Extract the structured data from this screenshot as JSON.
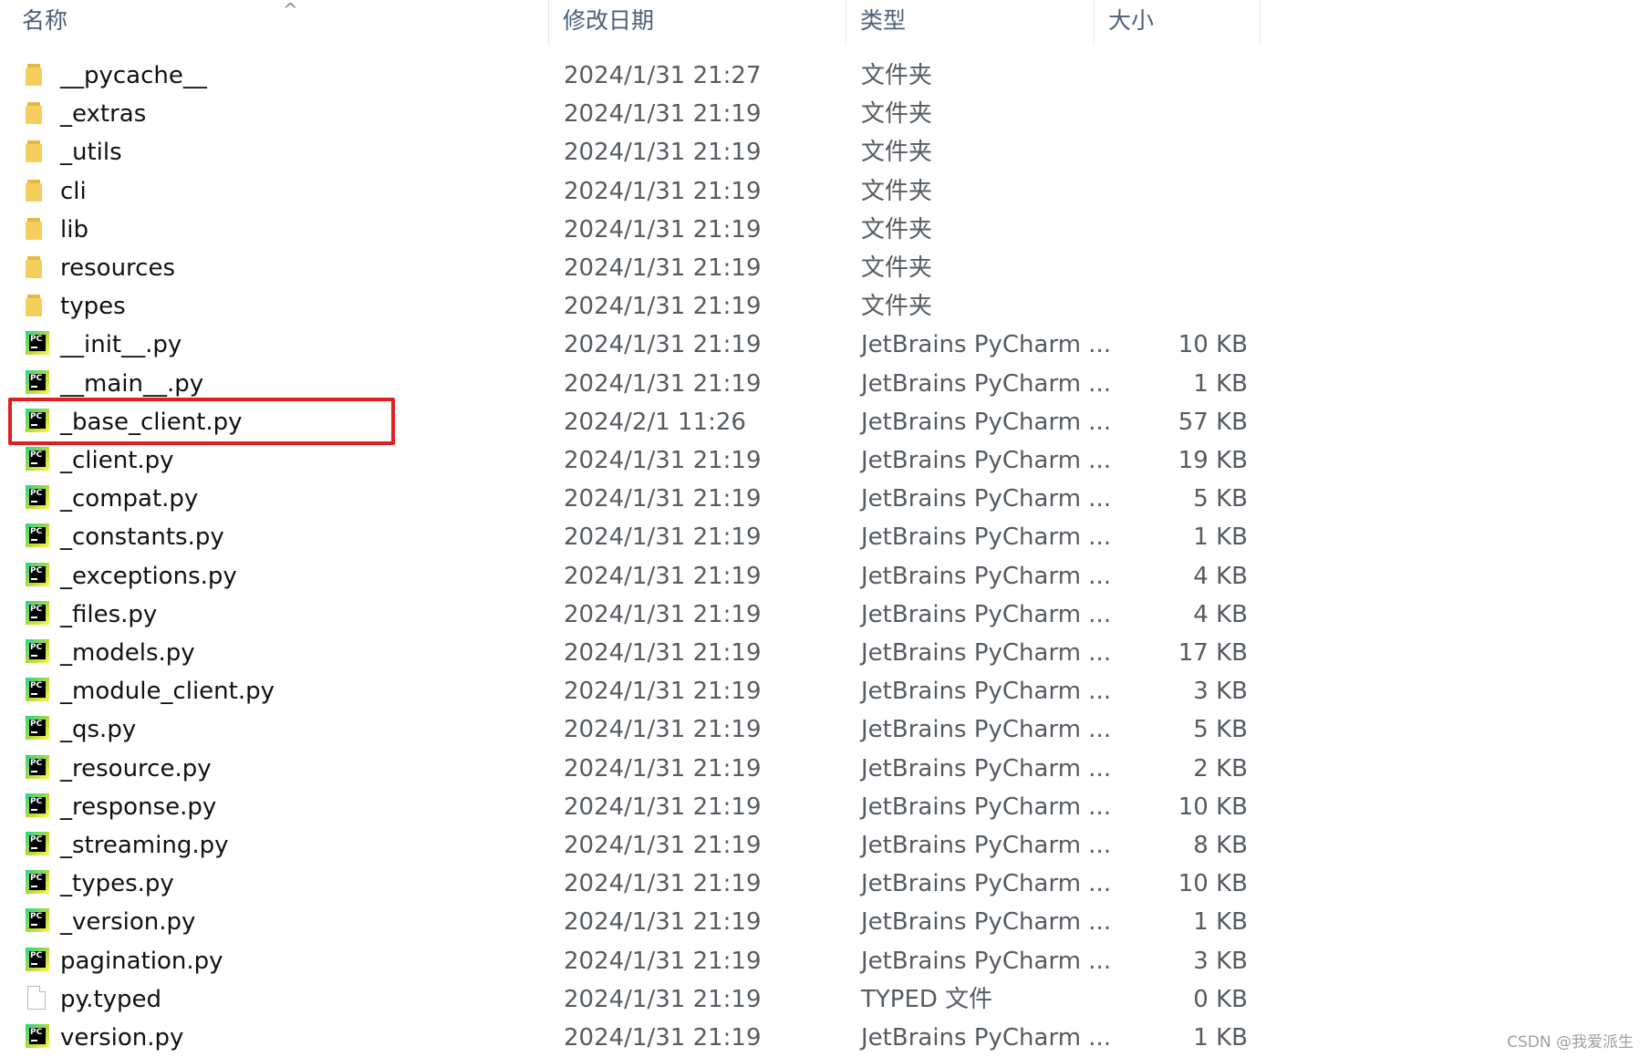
{
  "header": {
    "name": "名称",
    "date_modified": "修改日期",
    "type": "类型",
    "size": "大小",
    "sort_glyph": "^"
  },
  "files": [
    {
      "name": "__pycache__",
      "date": "2024/1/31 21:27",
      "type": "文件夹",
      "size": "",
      "icon": "folder-icon"
    },
    {
      "name": "_extras",
      "date": "2024/1/31 21:19",
      "type": "文件夹",
      "size": "",
      "icon": "folder-icon"
    },
    {
      "name": "_utils",
      "date": "2024/1/31 21:19",
      "type": "文件夹",
      "size": "",
      "icon": "folder-icon"
    },
    {
      "name": "cli",
      "date": "2024/1/31 21:19",
      "type": "文件夹",
      "size": "",
      "icon": "folder-icon"
    },
    {
      "name": "lib",
      "date": "2024/1/31 21:19",
      "type": "文件夹",
      "size": "",
      "icon": "folder-icon"
    },
    {
      "name": "resources",
      "date": "2024/1/31 21:19",
      "type": "文件夹",
      "size": "",
      "icon": "folder-icon"
    },
    {
      "name": "types",
      "date": "2024/1/31 21:19",
      "type": "文件夹",
      "size": "",
      "icon": "folder-icon"
    },
    {
      "name": "__init__.py",
      "date": "2024/1/31 21:19",
      "type": "JetBrains PyCharm ...",
      "size": "10 KB",
      "icon": "pycharm-file-icon"
    },
    {
      "name": "__main__.py",
      "date": "2024/1/31 21:19",
      "type": "JetBrains PyCharm ...",
      "size": "1 KB",
      "icon": "pycharm-file-icon"
    },
    {
      "name": "_base_client.py",
      "date": "2024/2/1 11:26",
      "type": "JetBrains PyCharm ...",
      "size": "57 KB",
      "icon": "pycharm-file-icon",
      "highlighted": true
    },
    {
      "name": "_client.py",
      "date": "2024/1/31 21:19",
      "type": "JetBrains PyCharm ...",
      "size": "19 KB",
      "icon": "pycharm-file-icon"
    },
    {
      "name": "_compat.py",
      "date": "2024/1/31 21:19",
      "type": "JetBrains PyCharm ...",
      "size": "5 KB",
      "icon": "pycharm-file-icon"
    },
    {
      "name": "_constants.py",
      "date": "2024/1/31 21:19",
      "type": "JetBrains PyCharm ...",
      "size": "1 KB",
      "icon": "pycharm-file-icon"
    },
    {
      "name": "_exceptions.py",
      "date": "2024/1/31 21:19",
      "type": "JetBrains PyCharm ...",
      "size": "4 KB",
      "icon": "pycharm-file-icon"
    },
    {
      "name": "_files.py",
      "date": "2024/1/31 21:19",
      "type": "JetBrains PyCharm ...",
      "size": "4 KB",
      "icon": "pycharm-file-icon"
    },
    {
      "name": "_models.py",
      "date": "2024/1/31 21:19",
      "type": "JetBrains PyCharm ...",
      "size": "17 KB",
      "icon": "pycharm-file-icon"
    },
    {
      "name": "_module_client.py",
      "date": "2024/1/31 21:19",
      "type": "JetBrains PyCharm ...",
      "size": "3 KB",
      "icon": "pycharm-file-icon"
    },
    {
      "name": "_qs.py",
      "date": "2024/1/31 21:19",
      "type": "JetBrains PyCharm ...",
      "size": "5 KB",
      "icon": "pycharm-file-icon"
    },
    {
      "name": "_resource.py",
      "date": "2024/1/31 21:19",
      "type": "JetBrains PyCharm ...",
      "size": "2 KB",
      "icon": "pycharm-file-icon"
    },
    {
      "name": "_response.py",
      "date": "2024/1/31 21:19",
      "type": "JetBrains PyCharm ...",
      "size": "10 KB",
      "icon": "pycharm-file-icon"
    },
    {
      "name": "_streaming.py",
      "date": "2024/1/31 21:19",
      "type": "JetBrains PyCharm ...",
      "size": "8 KB",
      "icon": "pycharm-file-icon"
    },
    {
      "name": "_types.py",
      "date": "2024/1/31 21:19",
      "type": "JetBrains PyCharm ...",
      "size": "10 KB",
      "icon": "pycharm-file-icon"
    },
    {
      "name": "_version.py",
      "date": "2024/1/31 21:19",
      "type": "JetBrains PyCharm ...",
      "size": "1 KB",
      "icon": "pycharm-file-icon"
    },
    {
      "name": "pagination.py",
      "date": "2024/1/31 21:19",
      "type": "JetBrains PyCharm ...",
      "size": "3 KB",
      "icon": "pycharm-file-icon"
    },
    {
      "name": "py.typed",
      "date": "2024/1/31 21:19",
      "type": "TYPED 文件",
      "size": "0 KB",
      "icon": "blank-file-icon"
    },
    {
      "name": "version.py",
      "date": "2024/1/31 21:19",
      "type": "JetBrains PyCharm ...",
      "size": "1 KB",
      "icon": "pycharm-file-icon"
    }
  ],
  "watermark": "CSDN @我爱派生",
  "colors": {
    "highlight": "#e0201f",
    "header_text": "#4c6077"
  }
}
